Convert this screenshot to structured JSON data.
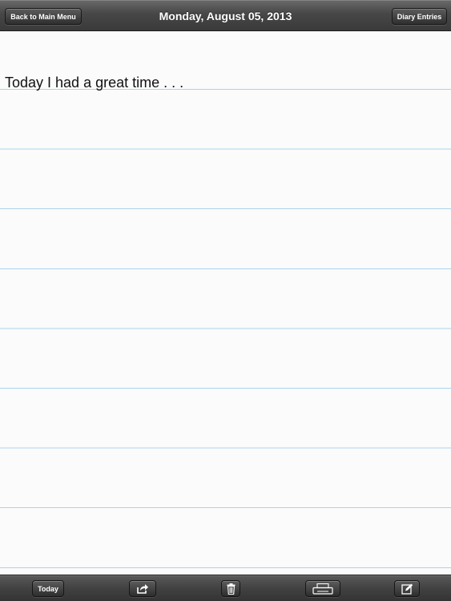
{
  "header": {
    "back_label": "Back to Main Menu",
    "title": "Monday, August 05, 2013",
    "entries_label": "Diary Entries"
  },
  "entry": {
    "text": "Today I had a great time . . ."
  },
  "toolbar": {
    "today_label": "Today",
    "icons": [
      "share-icon",
      "trash-icon",
      "print-icon",
      "compose-icon"
    ]
  },
  "colors": {
    "bar": "#474747",
    "paper": "#fbfbfb",
    "rule_line": "#a9d4ec",
    "text": "#111111"
  }
}
